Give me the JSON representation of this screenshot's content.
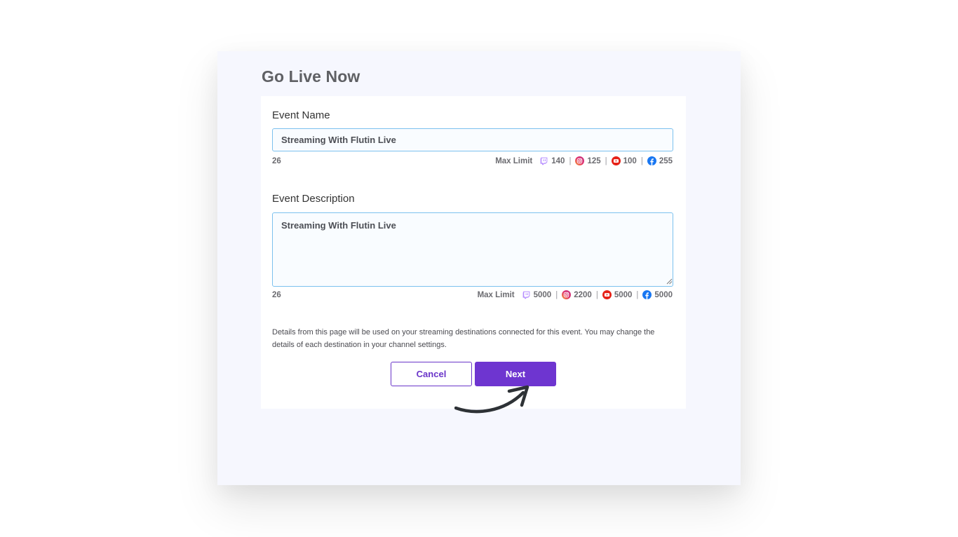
{
  "page": {
    "title": "Go Live Now"
  },
  "form": {
    "event_name": {
      "label": "Event Name",
      "value": "Streaming With Flutin Live",
      "count": "26",
      "max_limit_label": "Max Limit",
      "limits": {
        "twitch": "140",
        "instagram": "125",
        "youtube": "100",
        "facebook": "255"
      }
    },
    "event_description": {
      "label": "Event Description",
      "value": "Streaming With Flutin Live",
      "count": "26",
      "max_limit_label": "Max Limit",
      "limits": {
        "twitch": "5000",
        "instagram": "2200",
        "youtube": "5000",
        "facebook": "5000"
      }
    },
    "notice": "Details from this page will be used on your streaming destinations connected for this event. You may change the details of each destination in your channel settings.",
    "separator": "|",
    "cancel_label": "Cancel",
    "next_label": "Next"
  },
  "colors": {
    "accent": "#6e35d0",
    "panel_bg": "#f6f7fe",
    "input_border": "#7cc1ee",
    "twitch": "#9146ff",
    "youtube": "#e62117",
    "facebook": "#1877f2"
  },
  "icons": [
    "twitch-icon",
    "instagram-icon",
    "youtube-icon",
    "facebook-icon",
    "curved-arrow-icon",
    "resize-grip-icon"
  ]
}
